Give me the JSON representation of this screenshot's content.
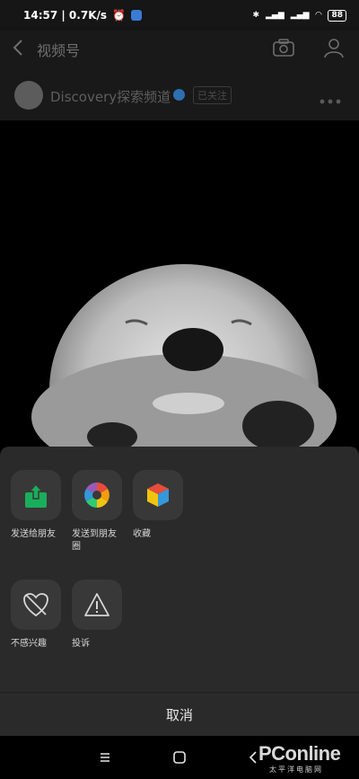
{
  "status_bar": {
    "time_speed": "14:57 | 0.7K/s",
    "battery": "88"
  },
  "nav": {
    "title": "视频号"
  },
  "channel": {
    "name": "Discovery探索频道",
    "follow": "已关注"
  },
  "share_options": [
    {
      "label": "发送给朋友",
      "icon": "share-export-icon"
    },
    {
      "label": "发送到朋友圈",
      "icon": "moments-aperture-icon"
    },
    {
      "label": "收藏",
      "icon": "favorites-cube-icon"
    },
    {
      "label": "不感兴趣",
      "icon": "broken-heart-icon"
    },
    {
      "label": "投诉",
      "icon": "warning-triangle-icon"
    }
  ],
  "cancel": {
    "label": "取消"
  },
  "watermark": {
    "brand": "PConline",
    "sub": "太平洋电脑网"
  },
  "colors": {
    "sheet": "#2a2a2a",
    "tile": "#383838",
    "green": "#1aad5b"
  }
}
